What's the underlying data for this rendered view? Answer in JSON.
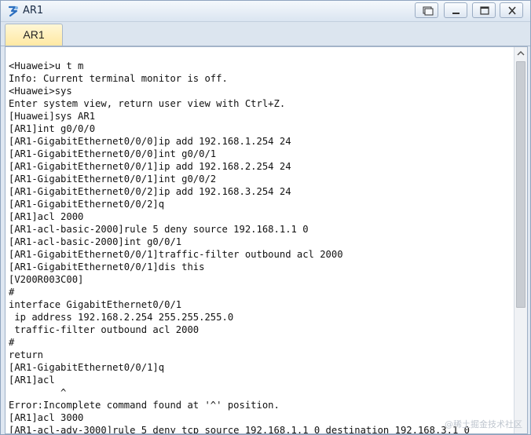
{
  "window": {
    "title": "AR1",
    "icon": "router-app-icon"
  },
  "titlebar_buttons": [
    "restore-icon",
    "minimize-icon",
    "maximize-icon",
    "close-icon"
  ],
  "tabs": [
    {
      "label": "AR1",
      "active": true
    }
  ],
  "console": {
    "lines": [
      "<Huawei>u t m",
      "Info: Current terminal monitor is off.",
      "<Huawei>sys",
      "Enter system view, return user view with Ctrl+Z.",
      "[Huawei]sys AR1",
      "[AR1]int g0/0/0",
      "[AR1-GigabitEthernet0/0/0]ip add 192.168.1.254 24",
      "[AR1-GigabitEthernet0/0/0]int g0/0/1",
      "[AR1-GigabitEthernet0/0/1]ip add 192.168.2.254 24",
      "[AR1-GigabitEthernet0/0/1]int g0/0/2",
      "[AR1-GigabitEthernet0/0/2]ip add 192.168.3.254 24",
      "[AR1-GigabitEthernet0/0/2]q",
      "[AR1]acl 2000",
      "[AR1-acl-basic-2000]rule 5 deny source 192.168.1.1 0",
      "[AR1-acl-basic-2000]int g0/0/1",
      "[AR1-GigabitEthernet0/0/1]traffic-filter outbound acl 2000",
      "[AR1-GigabitEthernet0/0/1]dis this",
      "[V200R003C00]",
      "#",
      "interface GigabitEthernet0/0/1",
      " ip address 192.168.2.254 255.255.255.0",
      " traffic-filter outbound acl 2000",
      "#",
      "return",
      "[AR1-GigabitEthernet0/0/1]q",
      "[AR1]acl",
      "         ^",
      "Error:Incomplete command found at '^' position.",
      "[AR1]acl 3000",
      "[AR1-acl-adv-3000]rule 5 deny tcp source 192.168.1.1 0 destination 192.168.3.1 0"
    ]
  },
  "watermark": "@稀土掘金技术社区",
  "colors": {
    "titlebar": "#dbe5f1",
    "tab_active": "#ffe9a3",
    "console_bg": "#ffffff",
    "console_text": "#111111"
  }
}
